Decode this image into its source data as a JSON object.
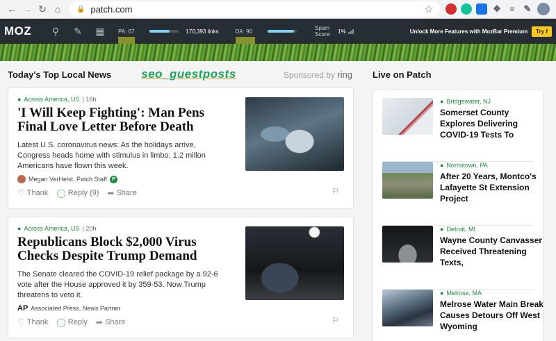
{
  "browser": {
    "url": "patch.com"
  },
  "mozbar": {
    "logo": "MOZ",
    "pa": "PA: 67",
    "pa_fill": 0.67,
    "links": "170,393 links",
    "da": "DA: 90",
    "da_fill": 0.9,
    "spam_label_1": "Spam",
    "spam_label_2": "Score:",
    "spam_value": "1%",
    "unlock": "Unlock More Features with MozBar Premium",
    "try": "Try f"
  },
  "left": {
    "title": "Today's Top Local News",
    "seo_tag": "seo_guestposts",
    "sponsored_prefix": "Sponsored by",
    "sponsor": "ring"
  },
  "articles": [
    {
      "location": "Across America, US",
      "time": "16h",
      "headline": "'I Will Keep Fighting': Man Pens Final Love Letter Before Death",
      "summary": "Latest U.S. coronavirus news: As the holidays arrive, Congress heads home with stimulus in limbo; 1.2 millon Americans have flown this week.",
      "author": "Megan VerHelst, Patch Staff",
      "author_badge": "P",
      "thank": "Thank",
      "reply": "Reply (9)",
      "share": "Share"
    },
    {
      "location": "Across America, US",
      "time": "20h",
      "headline": "Republicans Block $2,000 Virus Checks Despite Trump Demand",
      "summary": "The Senate cleared the COVID-19 relief package by a 92-6 vote after the House approved it by 359-53. Now Trump threatens to veto it.",
      "author_logo": "AP",
      "author": "Associated Press, News Partner",
      "thank": "Thank",
      "reply": "Reply",
      "share": "Share"
    }
  ],
  "live": {
    "title": "Live on Patch",
    "items": [
      {
        "location": "Bridgewater, NJ",
        "headline": "Somerset County Explores Delivering COVID-19 Tests To"
      },
      {
        "location": "Norristown, PA",
        "headline": "After 20 Years, Montco's Lafayette St Extension Project"
      },
      {
        "location": "Detroit, MI",
        "headline": "Wayne County Canvasser Received Threatening Texts,"
      },
      {
        "location": "Melrose, MA",
        "headline": "Melrose Water Main Break Causes Detours Off West Wyoming"
      }
    ]
  }
}
